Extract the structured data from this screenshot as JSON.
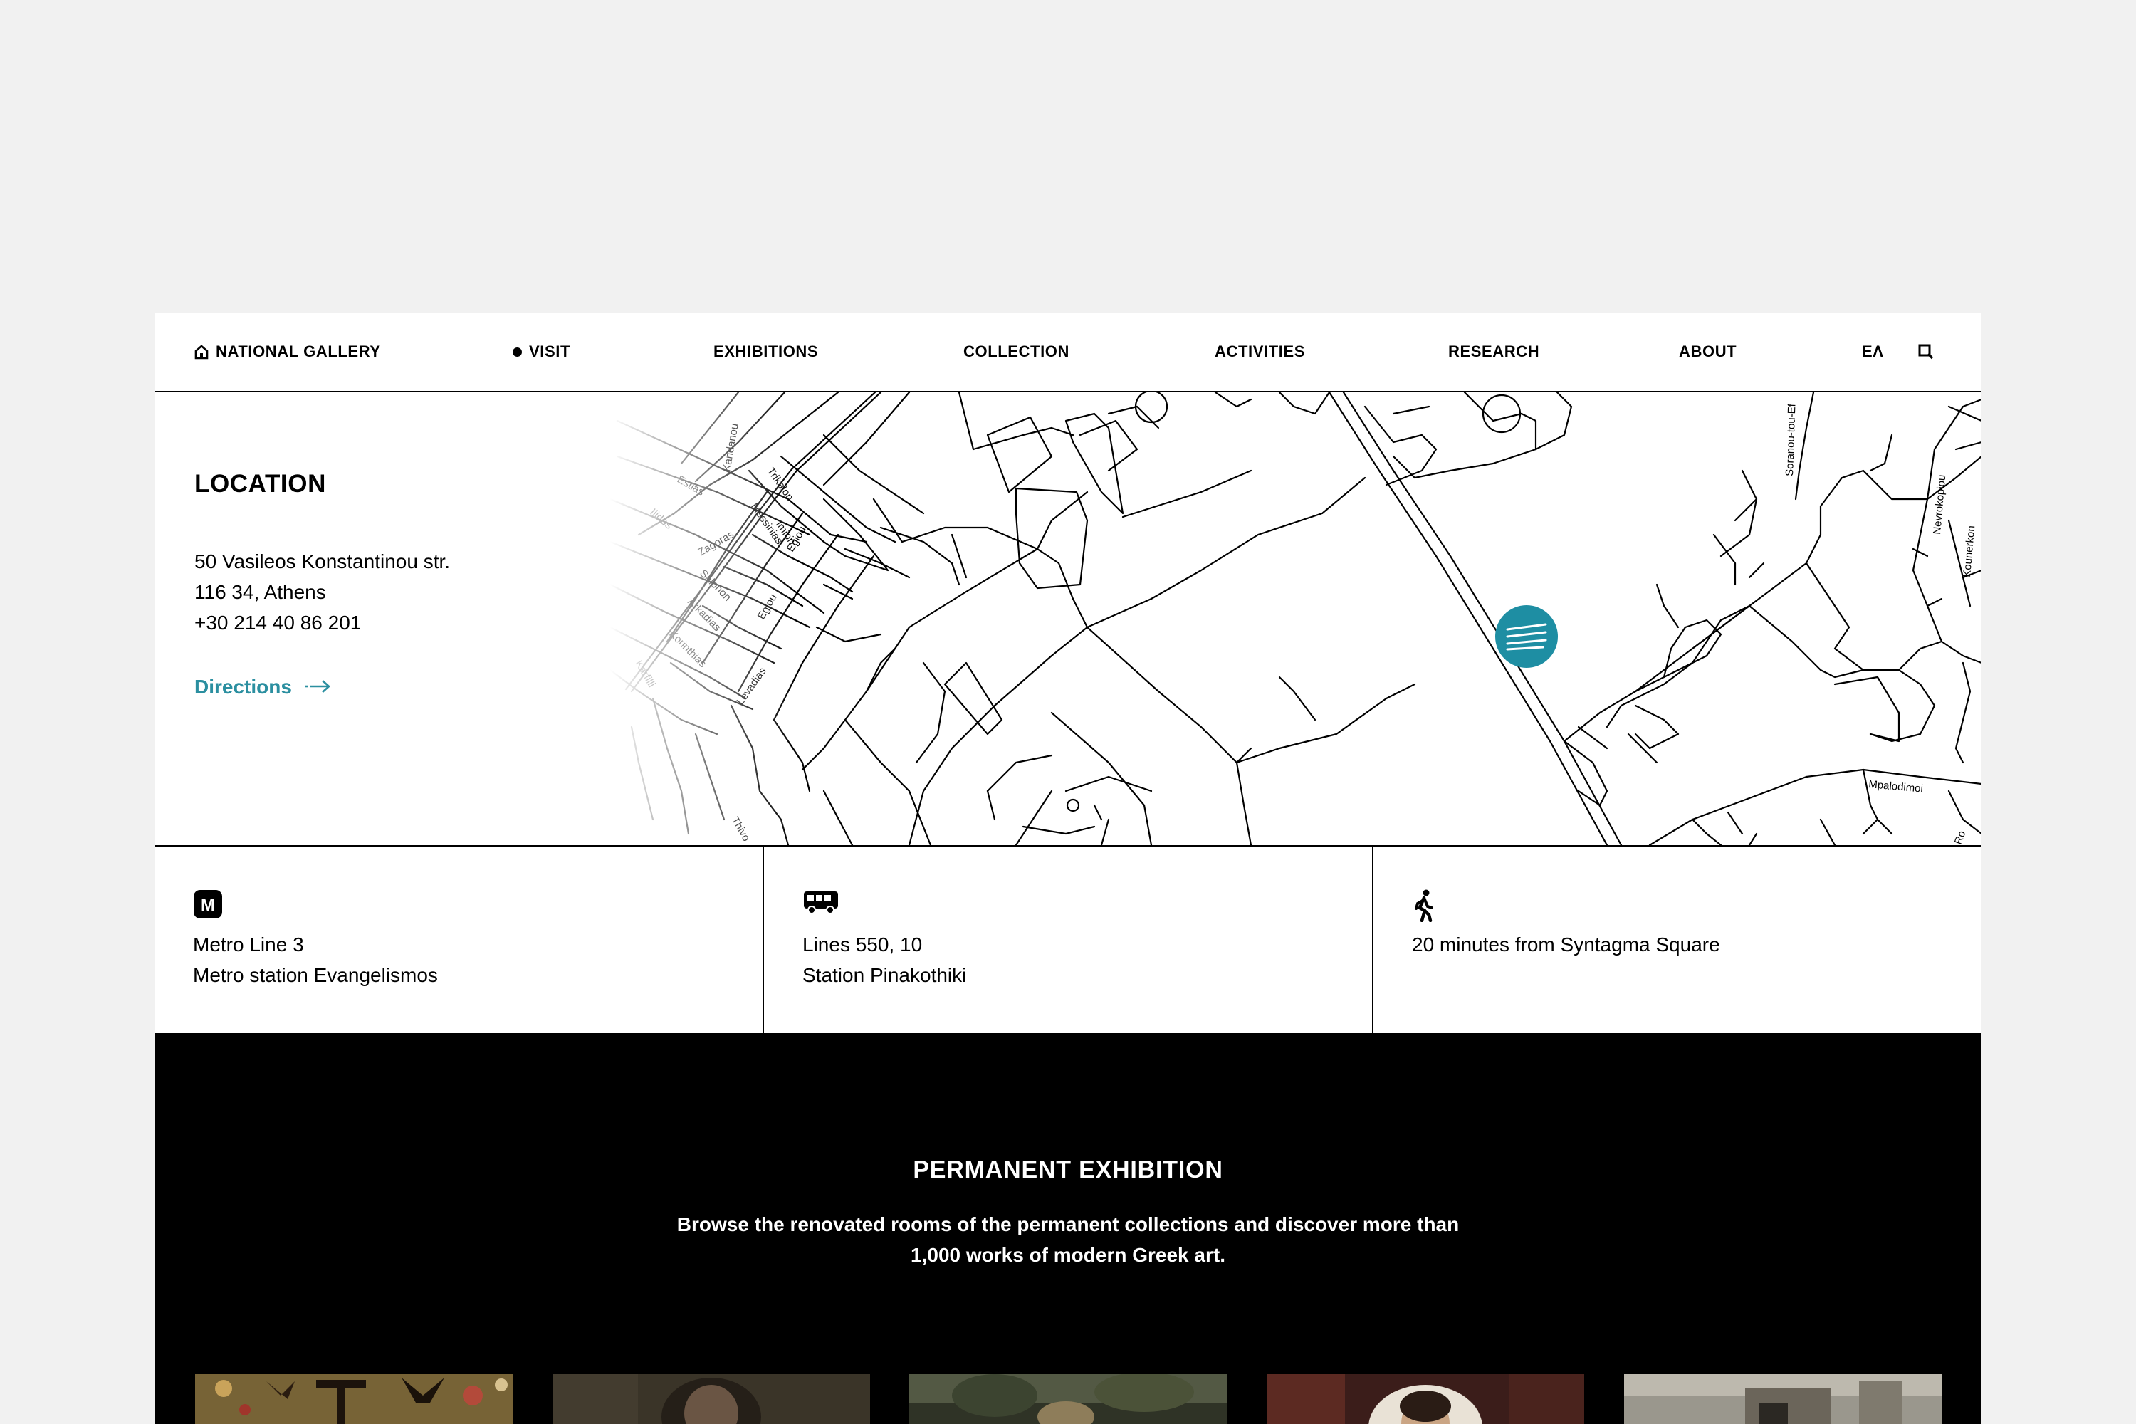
{
  "nav": {
    "home_label": "NATIONAL GALLERY",
    "items": [
      "VISIT",
      "EXHIBITIONS",
      "COLLECTION",
      "ACTIVITIES",
      "RESEARCH",
      "ABOUT"
    ],
    "lang": "ΕΛ"
  },
  "location": {
    "title": "LOCATION",
    "address_line1": "50 Vasileos Konstantinou str.",
    "address_line2": "116 34, Athens",
    "phone": "+30 214 40 86 201",
    "directions_label": "Directions"
  },
  "map": {
    "street_labels": [
      "Kandanou",
      "Estias",
      "Ilidos",
      "Trikalon",
      "Messinias",
      "Zagoras",
      "Imion",
      "Egiou",
      "Salonon",
      "Egiou",
      "Arkadias",
      "Korinthias",
      "Karfilli",
      "Levadias",
      "Thivo",
      "Soranou-tou-Ef",
      "Nevrokopiou",
      "Kounerkon",
      "Mpalodimoi",
      "Ro"
    ],
    "marker_color": "#1e8ea3"
  },
  "transport": {
    "metro_line": "Metro Line 3",
    "metro_station": "Metro station Evangelismos",
    "bus_lines": "Lines 550, 10",
    "bus_station": "Station Pinakothiki",
    "walk": "20 minutes from Syntagma Square"
  },
  "permanent": {
    "title": "PERMANENT EXHIBITION",
    "desc_line1": "Browse the renovated rooms of the permanent collections and discover more than",
    "desc_line2": "1,000 works of modern Greek art."
  },
  "colors": {
    "accent": "#2b8fa0",
    "background": "#f1f1f1"
  },
  "icons": [
    "home-icon",
    "search-icon",
    "arrow-right-icon",
    "metro-icon",
    "bus-icon",
    "walking-icon",
    "gallery-logo-marker-icon"
  ]
}
